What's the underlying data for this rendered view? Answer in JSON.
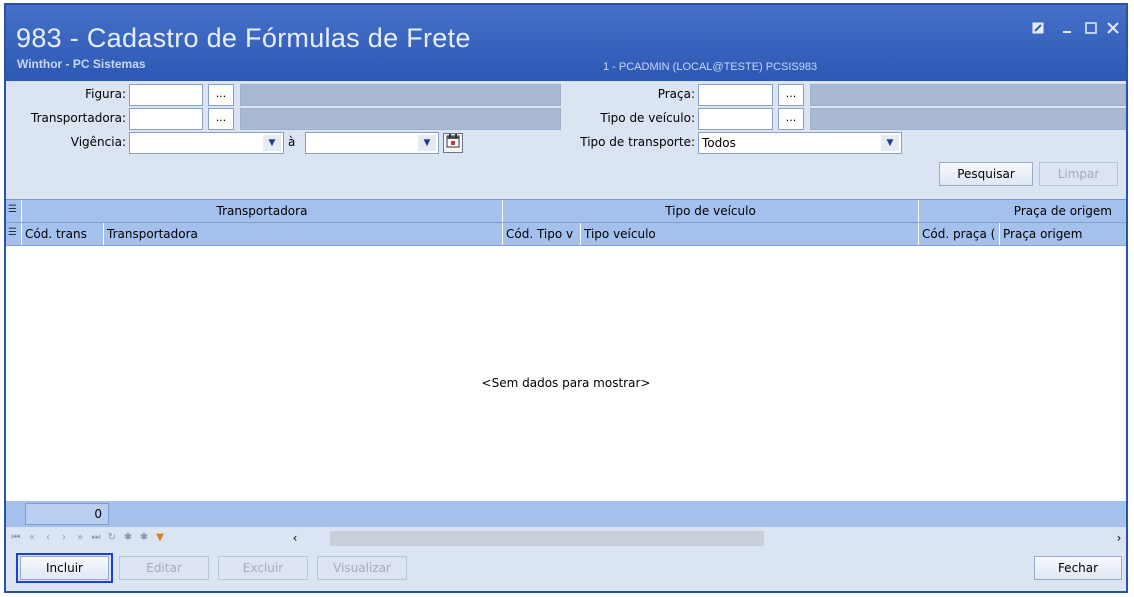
{
  "window": {
    "title": "983 - Cadastro de Fórmulas de Frete",
    "subtitle": "Winthor - PC Sistemas",
    "user_info": "1 - PCADMIN (LOCAL@TESTE)  PCSIS983",
    "controls": [
      "restore-icon",
      "minimize-icon",
      "maximize-icon",
      "close-icon"
    ]
  },
  "filters": {
    "figura_label": "Figura:",
    "transportadora_label": "Transportadora:",
    "vigencia_label": "Vigência:",
    "vigencia_sep": "à",
    "praca_label": "Praça:",
    "tipo_veiculo_label": "Tipo de veículo:",
    "tipo_transporte_label": "Tipo de transporte:",
    "tipo_transporte_value": "Todos",
    "browse_label": "...",
    "pesquisar": "Pesquisar",
    "limpar": "Limpar"
  },
  "grid": {
    "bands": [
      "Transportadora",
      "Tipo de veículo",
      "Praça de origem"
    ],
    "columns": [
      "Cód. trans",
      "Transportadora",
      "Cód. Tipo v",
      "Tipo veículo",
      "Cód. praça (",
      "Praça origem"
    ],
    "empty_text": "<Sem dados para mostrar>",
    "record_count": "0"
  },
  "actions": {
    "incluir": "Incluir",
    "editar": "Editar",
    "excluir": "Excluir",
    "visualizar": "Visualizar",
    "fechar": "Fechar"
  },
  "colors": {
    "title_bar": "#2f5bb8",
    "panel": "#dbe4f3",
    "grid_header": "#a4c0ec",
    "focus": "#1e3fd6"
  }
}
